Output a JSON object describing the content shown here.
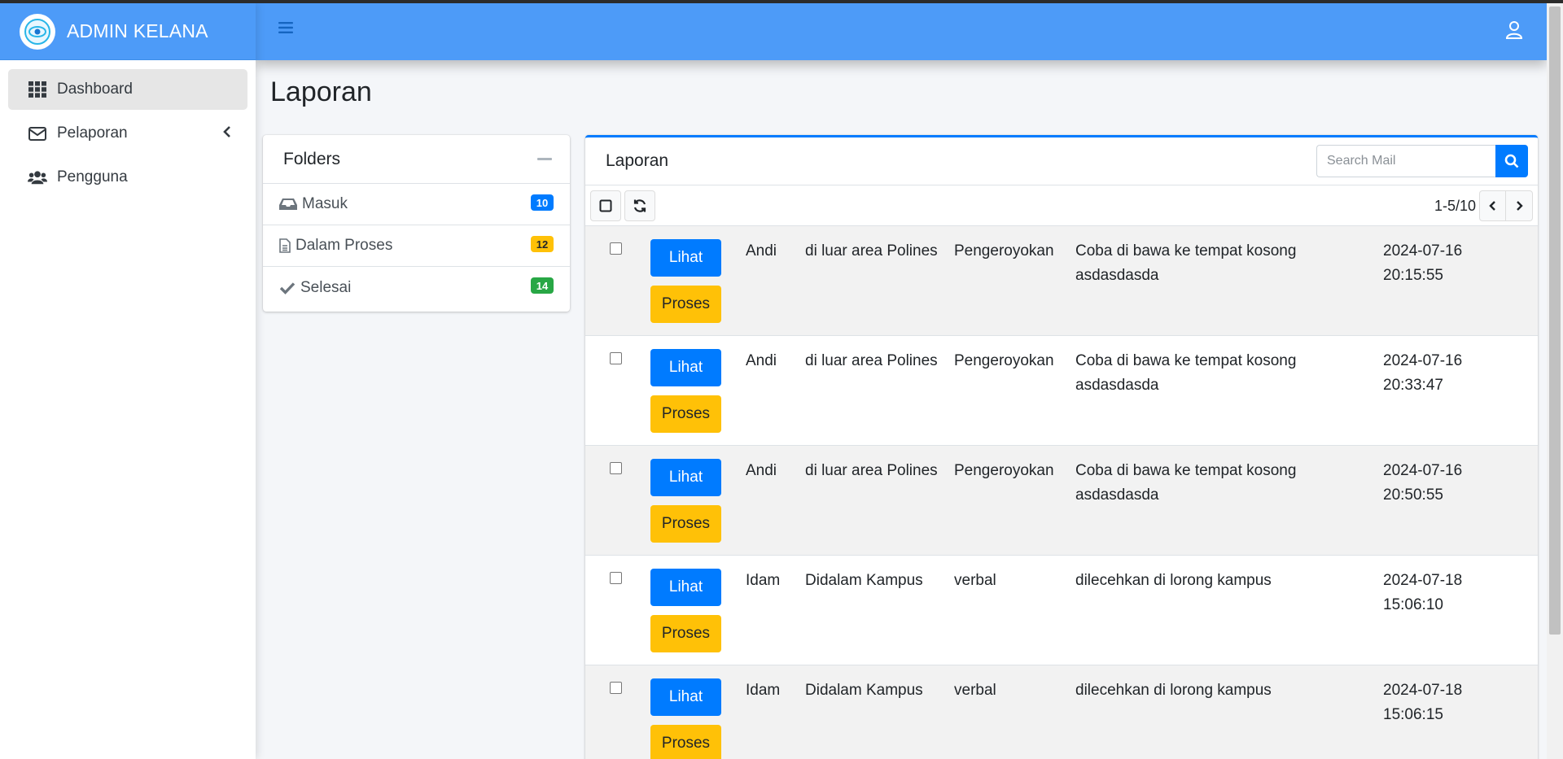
{
  "brand": {
    "title": "ADMIN KELANA"
  },
  "sidebar": {
    "items": [
      {
        "label": "Dashboard",
        "icon": "grid-icon",
        "active": true
      },
      {
        "label": "Pelaporan",
        "icon": "envelope-icon",
        "has_submenu": true
      },
      {
        "label": "Pengguna",
        "icon": "users-icon"
      }
    ]
  },
  "page": {
    "title": "Laporan"
  },
  "folders": {
    "title": "Folders",
    "items": [
      {
        "label": "Masuk",
        "icon": "inbox-icon",
        "count": "10",
        "badge_color": "#007bff"
      },
      {
        "label": "Dalam Proses",
        "icon": "file-icon",
        "count": "12",
        "badge_color": "#ffc107"
      },
      {
        "label": "Selesai",
        "icon": "check-icon",
        "count": "14",
        "badge_color": "#28a745"
      }
    ]
  },
  "mail": {
    "title": "Laporan",
    "search_placeholder": "Search Mail",
    "pagination": "1-5/10",
    "view_label": "Lihat",
    "process_label": "Proses",
    "rows": [
      {
        "name": "Andi",
        "location": "di luar area Polines",
        "type": "Pengeroyokan",
        "description": "Coba di bawa ke tempat kosong asdasdasda",
        "date": "2024-07-16",
        "time": "20:15:55"
      },
      {
        "name": "Andi",
        "location": "di luar area Polines",
        "type": "Pengeroyokan",
        "description": "Coba di bawa ke tempat kosong asdasdasda",
        "date": "2024-07-16",
        "time": "20:33:47"
      },
      {
        "name": "Andi",
        "location": "di luar area Polines",
        "type": "Pengeroyokan",
        "description": "Coba di bawa ke tempat kosong asdasdasda",
        "date": "2024-07-16",
        "time": "20:50:55"
      },
      {
        "name": "Idam",
        "location": "Didalam Kampus",
        "type": "verbal",
        "description": "dilecehkan di lorong kampus",
        "date": "2024-07-18",
        "time": "15:06:10"
      },
      {
        "name": "Idam",
        "location": "Didalam Kampus",
        "type": "verbal",
        "description": "dilecehkan di lorong kampus",
        "date": "2024-07-18",
        "time": "15:06:15"
      }
    ]
  },
  "colors": {
    "topbar": "#4d9bf8",
    "primary": "#007bff",
    "warning": "#ffc107",
    "success": "#28a745"
  }
}
